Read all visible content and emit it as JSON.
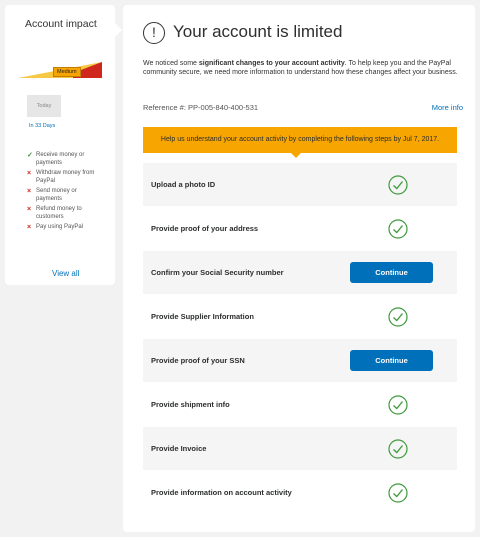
{
  "sidebar": {
    "title": "Account impact",
    "level_label": "Medium",
    "today_label": "Today",
    "days_link": "In 33 Days",
    "impacts": [
      {
        "text": "Receive money or payments",
        "status": "allowed"
      },
      {
        "text": "Withdraw money from PayPal",
        "status": "blocked"
      },
      {
        "text": "Send money or payments",
        "status": "blocked"
      },
      {
        "text": "Refund money to customers",
        "status": "blocked"
      },
      {
        "text": "Pay using PayPal",
        "status": "blocked"
      }
    ],
    "view_all": "View all"
  },
  "main": {
    "alert_glyph": "!",
    "title": "Your account is limited",
    "notice_prefix": "We noticed some ",
    "notice_bold": "significant changes to your account activity",
    "notice_suffix": ". To help keep you and the PayPal community secure, we need more information to understand how these changes affect your business.",
    "reference": "Reference #: PP-005-840-400-531",
    "more_info": "More info",
    "banner": "Help us understand your account activity by completing the following steps by Jul 7, 2017.",
    "steps": [
      {
        "label": "Upload a photo ID",
        "state": "done"
      },
      {
        "label": "Provide proof of your address",
        "state": "done"
      },
      {
        "label": "Confirm your Social Security number",
        "state": "action",
        "button": "Continue"
      },
      {
        "label": "Provide Supplier Information",
        "state": "done"
      },
      {
        "label": "Provide proof of your SSN",
        "state": "action",
        "button": "Continue"
      },
      {
        "label": "Provide shipment info",
        "state": "done"
      },
      {
        "label": "Provide Invoice",
        "state": "done"
      },
      {
        "label": "Provide information on account activity",
        "state": "done"
      }
    ]
  },
  "colors": {
    "accent_blue": "#0070ba",
    "banner_orange": "#f7a500",
    "check_green": "#3c9a3c",
    "blocked_red": "#d0271d"
  }
}
